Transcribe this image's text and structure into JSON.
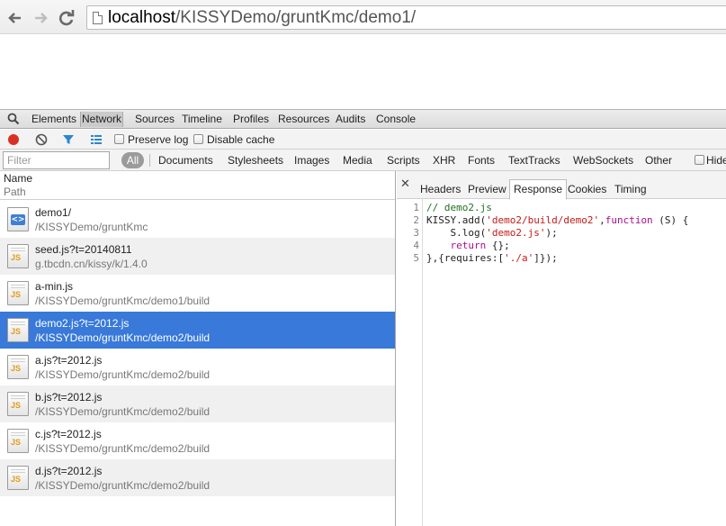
{
  "browser": {
    "url_host": "localhost",
    "url_path": "/KISSYDemo/gruntKmc/demo1/"
  },
  "devtools": {
    "tabs": [
      "Elements",
      "Network",
      "Sources",
      "Timeline",
      "Profiles",
      "Resources",
      "Audits",
      "Console"
    ],
    "active_tab": "Network"
  },
  "network": {
    "preserve_log_label": "Preserve log",
    "disable_cache_label": "Disable cache",
    "filter_placeholder": "Filter",
    "all_label": "All",
    "filter_types": [
      "Documents",
      "Stylesheets",
      "Images",
      "Media",
      "Scripts",
      "XHR",
      "Fonts",
      "TextTracks",
      "WebSockets",
      "Other"
    ],
    "hide_label": "Hide",
    "column_name": "Name",
    "column_path": "Path",
    "requests": [
      {
        "name": "demo1/",
        "path": "/KISSYDemo/gruntKmc",
        "icon": "html-file-icon",
        "icon_text": "<>"
      },
      {
        "name": "seed.js?t=20140811",
        "path": "g.tbcdn.cn/kissy/k/1.4.0",
        "icon": "js-file-icon",
        "icon_text": "JS"
      },
      {
        "name": "a-min.js",
        "path": "/KISSYDemo/gruntKmc/demo1/build",
        "icon": "js-file-icon",
        "icon_text": "JS"
      },
      {
        "name": "demo2.js?t=2012.js",
        "path": "/KISSYDemo/gruntKmc/demo2/build",
        "icon": "js-file-icon",
        "icon_text": "JS"
      },
      {
        "name": "a.js?t=2012.js",
        "path": "/KISSYDemo/gruntKmc/demo2/build",
        "icon": "js-file-icon",
        "icon_text": "JS"
      },
      {
        "name": "b.js?t=2012.js",
        "path": "/KISSYDemo/gruntKmc/demo2/build",
        "icon": "js-file-icon",
        "icon_text": "JS"
      },
      {
        "name": "c.js?t=2012.js",
        "path": "/KISSYDemo/gruntKmc/demo2/build",
        "icon": "js-file-icon",
        "icon_text": "JS"
      },
      {
        "name": "d.js?t=2012.js",
        "path": "/KISSYDemo/gruntKmc/demo2/build",
        "icon": "js-file-icon",
        "icon_text": "JS"
      }
    ],
    "selected_request": "demo2.js?t=2012.js"
  },
  "detail": {
    "close_glyph": "✕",
    "tabs": [
      "Headers",
      "Preview",
      "Response",
      "Cookies",
      "Timing"
    ],
    "active_tab": "Response",
    "line_numbers": [
      "1",
      "2",
      "3",
      "4",
      "5"
    ],
    "code": [
      {
        "comment": "// demo2.js"
      },
      {
        "p1": "KISSY.add(",
        "s1": "'demo2/build/demo2'",
        "p2": ",",
        "kw": "function",
        "p3": " (S) {"
      },
      {
        "p1": "    S.log(",
        "s1": "'demo2.js'",
        "p2": ");"
      },
      {
        "p1": "    ",
        "kw": "return",
        "p2": " {};"
      },
      {
        "p1": "},{requires:[",
        "s1": "'./a'",
        "p2": "]});"
      }
    ]
  },
  "colors": {
    "selection": "#3879d9",
    "record": "#d93025",
    "filter_icon": "#2a86d1"
  }
}
